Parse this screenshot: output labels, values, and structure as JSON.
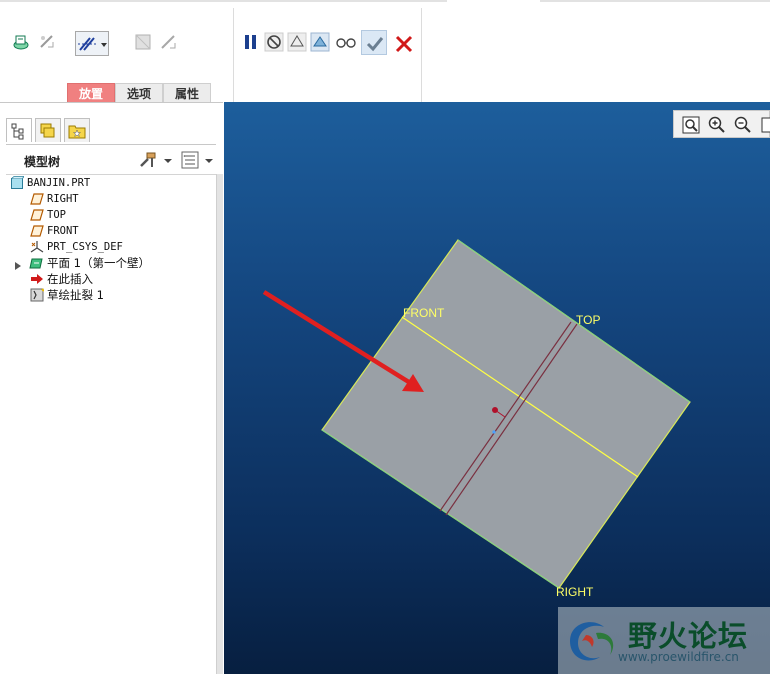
{
  "ribbon": {
    "tabs": [
      {
        "label": "放置",
        "active": true
      },
      {
        "label": "选项",
        "active": false
      },
      {
        "label": "属性",
        "active": false
      }
    ],
    "tools": [
      "sheetmetal-wall-icon",
      "feature-shape-icon",
      "sketch-flat-icon",
      "dropdown-icon",
      "sheet-thicken-icon",
      "flip-icon",
      "pause-icon",
      "no-preview-icon",
      "geometry-preview-icon",
      "verify-preview-icon",
      "glasses-icon",
      "confirm-icon",
      "cancel-icon"
    ]
  },
  "panel": {
    "tabs": [
      "model-tree-icon",
      "layer-icon",
      "favorites-folder-icon"
    ],
    "title": "模型树",
    "tree": [
      {
        "label": "BANJIN.PRT",
        "icon": "part-icon"
      },
      {
        "label": "RIGHT",
        "icon": "datum-plane-icon"
      },
      {
        "label": "TOP",
        "icon": "datum-plane-icon"
      },
      {
        "label": "FRONT",
        "icon": "datum-plane-icon"
      },
      {
        "label": "PRT_CSYS_DEF",
        "icon": "coordinate-system-icon"
      },
      {
        "label": "平面 1（第一个壁）",
        "icon": "flat-wall-icon"
      },
      {
        "label": "在此插入",
        "icon": "insert-here-icon"
      },
      {
        "label": "草绘扯裂 1",
        "icon": "sketch-rip-icon"
      }
    ]
  },
  "viewport": {
    "plane_labels": {
      "front": "FRONT",
      "top": "TOP",
      "right": "RIGHT"
    },
    "view_tools": [
      "refit-icon",
      "zoom-in-icon",
      "zoom-out-icon",
      "repaint-icon"
    ]
  },
  "watermark": {
    "title": "野火论坛",
    "url": "www.proewildfire.cn"
  },
  "colors": {
    "accent_tab": "#f08080",
    "plane_label": "#ffff66",
    "arrow": "#e02020",
    "sheet": "#9aa0a6"
  }
}
